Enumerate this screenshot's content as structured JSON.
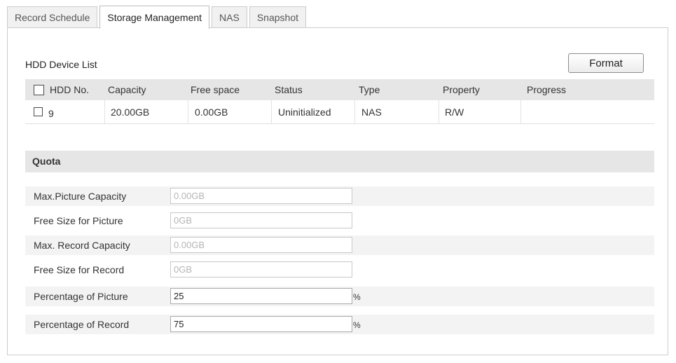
{
  "tabs": [
    {
      "label": "Record Schedule",
      "active": false
    },
    {
      "label": "Storage Management",
      "active": true
    },
    {
      "label": "NAS",
      "active": false
    },
    {
      "label": "Snapshot",
      "active": false
    }
  ],
  "hdd": {
    "title": "HDD Device List",
    "format_label": "Format",
    "columns": [
      "HDD No.",
      "Capacity",
      "Free space",
      "Status",
      "Type",
      "Property",
      "Progress"
    ],
    "rows": [
      {
        "hdd_no": "9",
        "capacity": "20.00GB",
        "free_space": "0.00GB",
        "status": "Uninitialized",
        "type": "NAS",
        "property": "R/W",
        "progress": ""
      }
    ]
  },
  "quota": {
    "title": "Quota",
    "fields": [
      {
        "label": "Max.Picture Capacity",
        "value": "0.00GB",
        "disabled": true,
        "unit": ""
      },
      {
        "label": "Free Size for Picture",
        "value": "0GB",
        "disabled": true,
        "unit": ""
      },
      {
        "label": "Max. Record Capacity",
        "value": "0.00GB",
        "disabled": true,
        "unit": ""
      },
      {
        "label": "Free Size for Record",
        "value": "0GB",
        "disabled": true,
        "unit": ""
      },
      {
        "label": "Percentage of Picture",
        "value": "25",
        "disabled": false,
        "unit": "%"
      },
      {
        "label": "Percentage of Record",
        "value": "75",
        "disabled": false,
        "unit": "%"
      }
    ]
  },
  "colors": {
    "header_bg": "#e6e6e6",
    "alt_row_bg": "#f3f3f3",
    "disabled_text": "#b5b5b5"
  }
}
